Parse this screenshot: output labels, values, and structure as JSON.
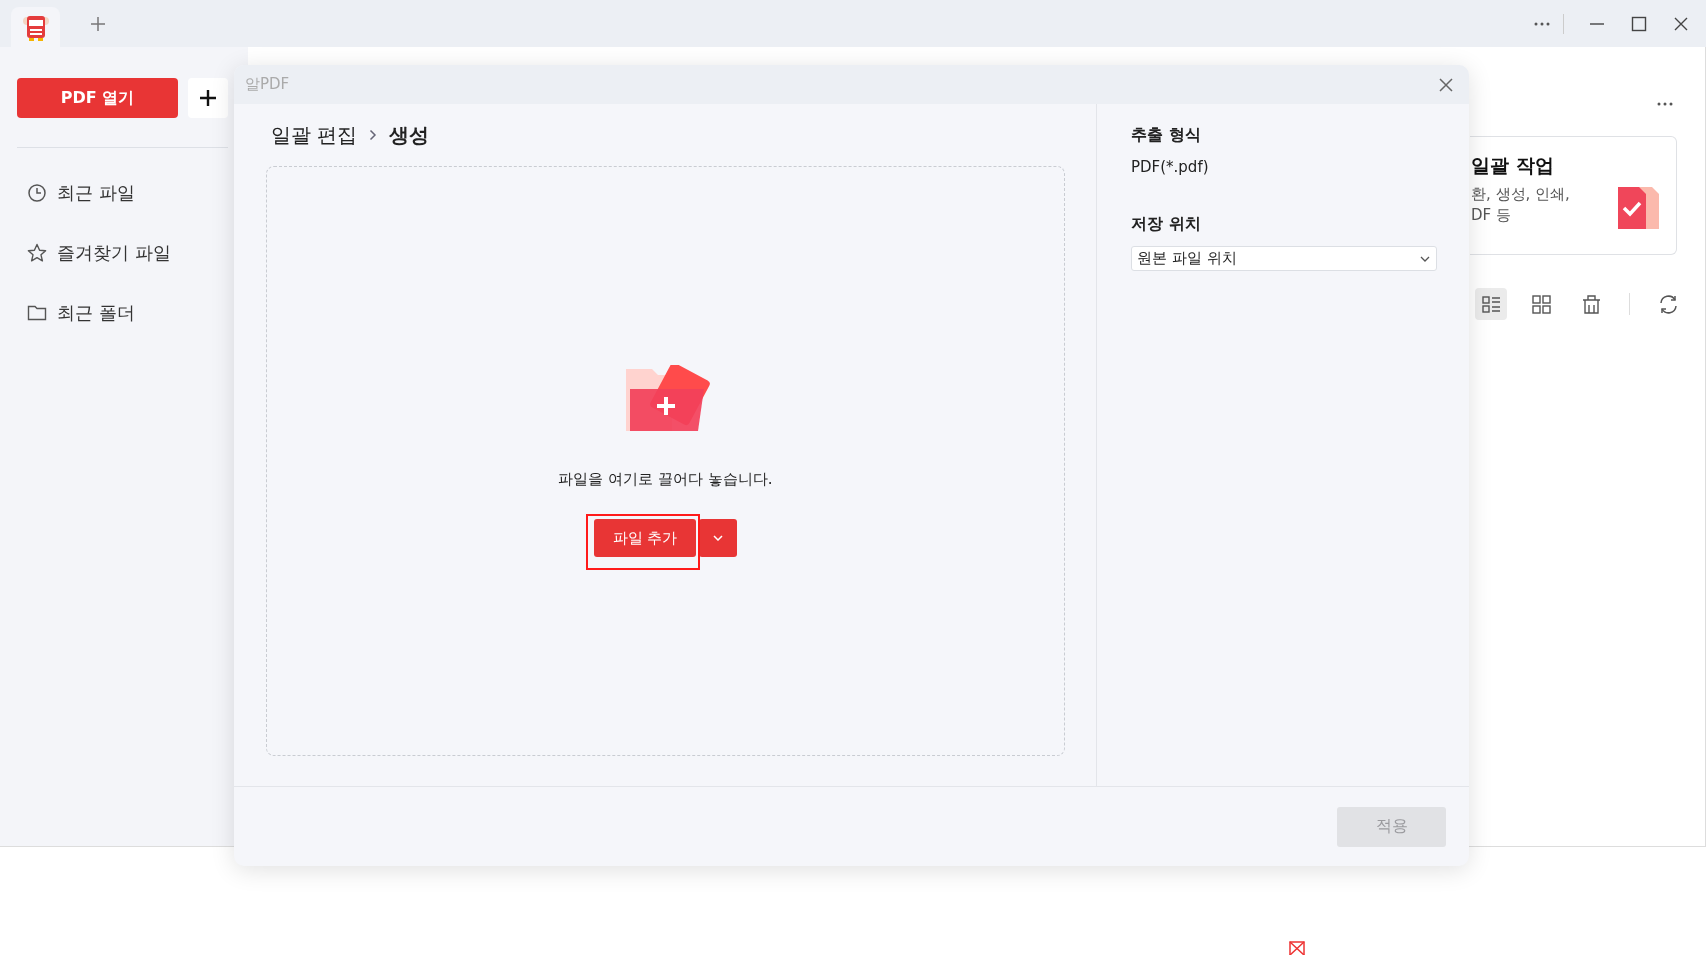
{
  "sidebar": {
    "open_button": "PDF 열기",
    "items": [
      {
        "kind": "clock",
        "label": "최근 파일"
      },
      {
        "kind": "star",
        "label": "즐겨찾기 파일"
      },
      {
        "kind": "folder",
        "label": "최근 폴더"
      }
    ]
  },
  "background": {
    "card": {
      "title": "일괄 작업",
      "lines": [
        "환, 생성, 인쇄,",
        "DF 등"
      ]
    },
    "view_buttons": [
      {
        "kind": "list",
        "selected": true
      },
      {
        "kind": "grid",
        "selected": false
      },
      {
        "kind": "bin",
        "selected": false
      }
    ]
  },
  "dialog": {
    "title": "알PDF",
    "breadcrumb": [
      {
        "label": "일괄 편집",
        "current": false
      },
      {
        "label": "생성",
        "current": true
      }
    ],
    "drop_zone": {
      "hint": "파일을 여기로 끌어다 놓습니다.",
      "add_button": "파일 추가",
      "highlighted": true
    },
    "settings": [
      {
        "kind": "text",
        "label": "추출 형식",
        "value": "PDF(*.pdf)"
      },
      {
        "kind": "select",
        "label": "저장 위치",
        "value": "원본 파일 위치"
      }
    ],
    "apply_button": {
      "label": "적용",
      "disabled": true
    }
  }
}
